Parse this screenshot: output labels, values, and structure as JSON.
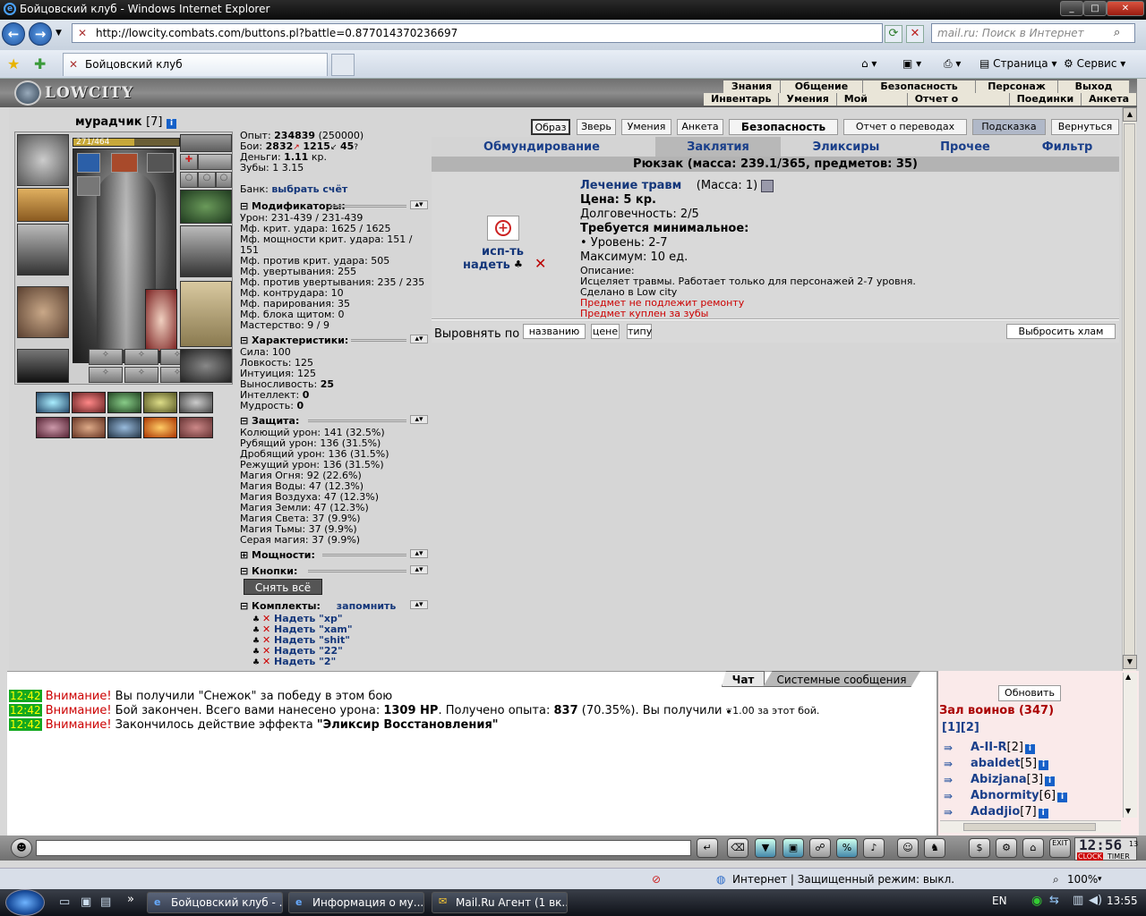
{
  "window": {
    "title": "Бойцовский клуб - Windows Internet Explorer"
  },
  "browser": {
    "url": "http://lowcity.combats.com/buttons.pl?battle=0.877014370236697",
    "search_placeholder": "mail.ru: Поиск в Интернет",
    "tab_title": "Бойцовский клуб",
    "page_menu": "Страница",
    "tools_menu": "Сервис",
    "status_zone": "Интернет | Защищенный режим: выкл.",
    "zoom": "100%"
  },
  "game": {
    "logo": "LOWCITY",
    "top_menu": [
      "Знания",
      "Общение",
      "Безопасность",
      "Персонаж",
      "Выход"
    ],
    "sub_menu": [
      "Инвентарь",
      "Умения",
      "Мой Скролл",
      "Отчет о переводах",
      "Поединки",
      "Анкета"
    ]
  },
  "player": {
    "name": "мурадчик",
    "level": "[7]",
    "hp": "271/464",
    "hp_fraction": 0.58,
    "experience_label": "Опыт:",
    "experience": "234839",
    "experience_next": "(250000)",
    "battles_label": "Бои:",
    "wins": "2832",
    "losses": "1215",
    "draws": "45",
    "money_label": "Деньги:",
    "money": "1.11",
    "money_unit": "кр.",
    "teeth_label": "Зубы:",
    "teeth": "1 3.15",
    "bank_label": "Банк:",
    "bank_link": "выбрать счёт"
  },
  "sections": {
    "modifiers": "Модификаторы:",
    "characteristics": "Характеристики:",
    "defense": "Защита:",
    "powers": "Мощности:",
    "buttons": "Кнопки:",
    "sets": "Комплекты:",
    "sets_remember": "запомнить",
    "undress_all": "Снять всё"
  },
  "modifiers": [
    "Урон: 231-439 / 231-439",
    "Мф. крит. удара: 1625 / 1625",
    "Мф. мощности крит. удара: 151 /",
    "151",
    "Мф. против крит. удара: 505",
    "Мф. увертывания: 255",
    "Мф. против увертывания: 235 / 235",
    "Мф. контрудара: 10",
    "Мф. парирования: 35",
    "Мф. блока щитом: 0",
    "Мастерство: 9 / 9"
  ],
  "characteristics": [
    {
      "label": "Сила: ",
      "value": "100"
    },
    {
      "label": "Ловкость: ",
      "value": "125"
    },
    {
      "label": "Интуиция: ",
      "value": "125"
    },
    {
      "label": "Выносливость: ",
      "value": "25"
    },
    {
      "label": "Интеллект: ",
      "value": "0"
    },
    {
      "label": "Мудрость: ",
      "value": "0"
    }
  ],
  "defense": [
    "Колющий урон: 141 (32.5%)",
    "Рубящий урон: 136 (31.5%)",
    "Дробящий урон: 136 (31.5%)",
    "Режущий урон: 136 (31.5%)",
    "Магия Огня: 92 (22.6%)",
    "Магия Воды: 47 (12.3%)",
    "Магия Воздуха: 47 (12.3%)",
    "Магия Земли: 47 (12.3%)",
    "Магия Света: 37 (9.9%)",
    "Магия Тьмы: 37 (9.9%)",
    "Серая магия: 37 (9.9%)"
  ],
  "sets": [
    "Надеть \"xp\"",
    "Надеть \"xam\"",
    "Надеть \"shit\"",
    "Надеть \"22\"",
    "Надеть \"2\""
  ],
  "top_buttons": [
    "Образ",
    "Зверь",
    "Умения",
    "Анкета",
    "Безопасность",
    "Отчет о переводах",
    "Подсказка",
    "Вернуться"
  ],
  "categories": [
    "Обмундирование",
    "Заклятия",
    "Эликсиры",
    "Прочее",
    "Фильтр"
  ],
  "inventory": {
    "header": "Рюкзак (масса: 239.1/365, предметов: 35)",
    "item": {
      "name": "Лечение травм",
      "mass": "(Масса: 1)",
      "use": "исп-ть",
      "wear": "надеть",
      "price": "Цена: 5 кр.",
      "durability": "Долговечность: 2/5",
      "req_title": "Требуется минимальное:",
      "req_level": "• Уровень: 2-7",
      "max": "Максимум: 10 ед.",
      "desc_title": "Описание:",
      "desc": "Исцеляет травмы. Работает только для персонажей 2-7 уровня.",
      "made": "Сделано в Low city",
      "no_repair": "Предмет не подлежит ремонту",
      "bought": "Предмет куплен за зубы"
    },
    "sort_label": "Выровнять по",
    "sort_buttons": [
      "названию",
      "цене",
      "типу"
    ],
    "drop_junk": "Выбросить хлам"
  },
  "chat": {
    "tabs": [
      "Чат",
      "Системные сообщения"
    ],
    "messages": [
      {
        "time": "12:42",
        "warn": "Внимание!",
        "text": " Вы получили \"Снежок\" за победу в этом бою"
      },
      {
        "time": "12:42",
        "warn": "Внимание!",
        "text": " Бой закончен. Всего вами нанесено урона: ",
        "b1": "1309 HP",
        "t2": ". Получено опыта: ",
        "b2": "837",
        "t3": " (70.35%). Вы получили ",
        "t4": "1.00 за этот бой."
      },
      {
        "time": "12:42",
        "warn": "Внимание!",
        "text": " Закончилось действие эффекта ",
        "b1": "\"Эликсир Восстановления\""
      }
    ]
  },
  "room": {
    "refresh": "Обновить",
    "title": "Зал воинов (347)",
    "pages": "[1][2]",
    "users": [
      {
        "name": "A-II-R",
        "level": "[2]"
      },
      {
        "name": "abaldet",
        "level": "[5]"
      },
      {
        "name": "Abizjana",
        "level": "[3]"
      },
      {
        "name": "Abnormity",
        "level": "[6]"
      },
      {
        "name": "Adadjio",
        "level": "[7]"
      }
    ]
  },
  "game_clock": {
    "time": "12:56",
    "sec": "13",
    "label1": "CLOCK",
    "label2": "TIMER"
  },
  "taskbar": {
    "tasks": [
      "Бойцовский клуб - ...",
      "Информация о му...",
      "Mail.Ru Агент (1 вк..."
    ],
    "lang": "EN",
    "time": "13:55"
  },
  "colors": {
    "accent": "#1a3f8a",
    "warning": "#cc0000",
    "time_bg": "#13a81f"
  }
}
